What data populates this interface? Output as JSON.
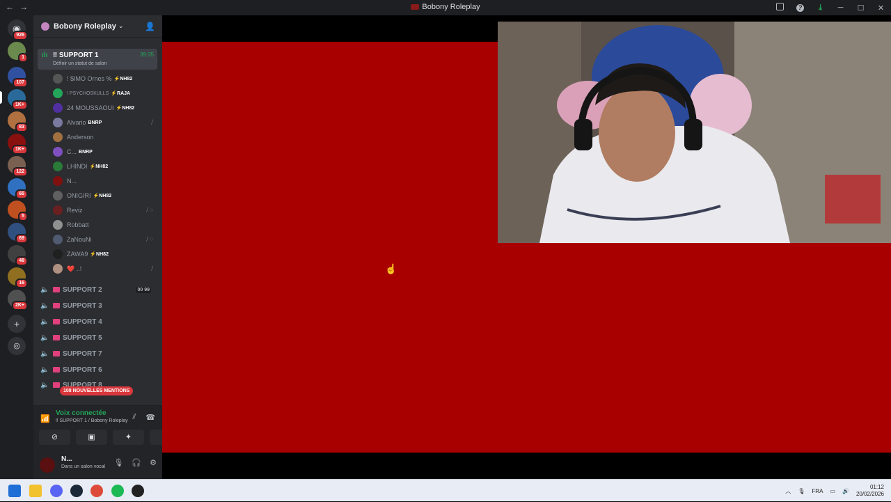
{
  "window": {
    "title": "Bobony Roleplay",
    "back": "←",
    "forward": "→"
  },
  "server": {
    "name": "Bobony Roleplay"
  },
  "guild_badges": [
    "926",
    "1",
    "107",
    "1K+",
    "83",
    "1K+",
    "122",
    "65",
    "5",
    "69",
    "48",
    "16",
    "2K+"
  ],
  "active_channel": {
    "name": "‼ SUPPORT 1",
    "time": "39:35",
    "status": "Définir un statut de salon"
  },
  "members": [
    {
      "name": "! $IMO Ornes %",
      "tag": "⚡NH82"
    },
    {
      "name": "! PSYCHOSKULLS",
      "tag": "⚡RAJA"
    },
    {
      "name": "24 MOUSSAOUI",
      "tag": "⚡NH82"
    },
    {
      "name": "Alvario",
      "tag": "BNRP"
    },
    {
      "name": "Anderson",
      "tag": ""
    },
    {
      "name": "C...",
      "tag": "BNRP"
    },
    {
      "name": "LHINDI",
      "tag": "⚡NH82"
    },
    {
      "name": "N...",
      "tag": ""
    },
    {
      "name": "ONIGIRI",
      "tag": "⚡NH82"
    },
    {
      "name": "Reviz",
      "tag": ""
    },
    {
      "name": "Robbatt",
      "tag": ""
    },
    {
      "name": "ZaNouNi",
      "tag": ""
    },
    {
      "name": "ZAWA9",
      "tag": "⚡NH82"
    },
    {
      "name": "❤️ ..!",
      "tag": ""
    }
  ],
  "voice_channels": [
    {
      "name": "SUPPORT 2",
      "count1": "00",
      "count2": "99"
    },
    {
      "name": "SUPPORT 3"
    },
    {
      "name": "SUPPORT 4"
    },
    {
      "name": "SUPPORT 5"
    },
    {
      "name": "SUPPORT 7"
    },
    {
      "name": "SUPPORT 6"
    },
    {
      "name": "SUPPORT 8"
    }
  ],
  "mentions": "108 NOUVELLES MENTIONS",
  "voice": {
    "connected": "Voix connectée",
    "location": "‼ SUPPORT 1 / Bobony Roleplay"
  },
  "user": {
    "name": "N...",
    "status": "Dans un salon vocal"
  },
  "taskbar": {
    "lang": "FRA",
    "time": "01:12",
    "date": "20/02/2026"
  },
  "colors": {
    "accent_green": "#23a55a",
    "mention_red": "#da373c",
    "stream_red": "#a80000"
  }
}
